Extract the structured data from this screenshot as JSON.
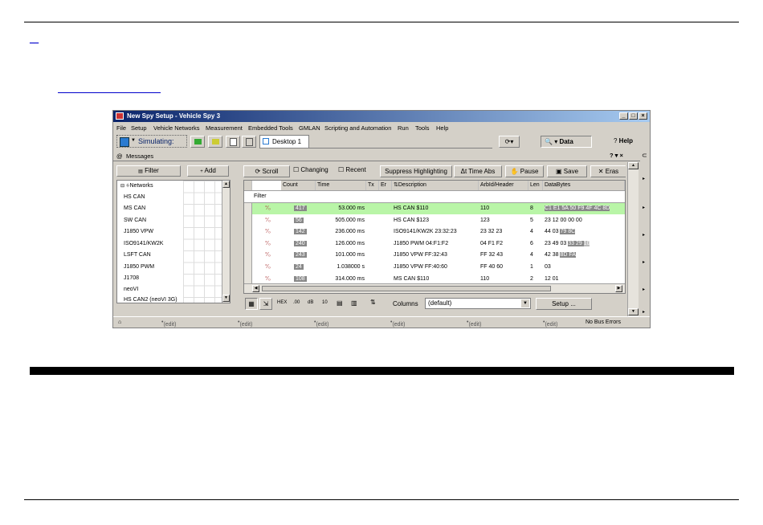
{
  "page": {
    "top_link": "__",
    "link2": ""
  },
  "app": {
    "title": "New Spy Setup - Vehicle Spy 3",
    "window_buttons": [
      "_",
      "□",
      "×"
    ],
    "menus": [
      "File",
      "Setup",
      "Vehicle Networks",
      "Measurement",
      "Embedded Tools",
      "GMLAN",
      "Scripting and Automation",
      "Run",
      "Tools",
      "Help"
    ],
    "toolbar": {
      "mode": "Simulating:",
      "desktop_tab": "Desktop 1",
      "data_label": "Data",
      "help_label": "Help"
    },
    "pane": {
      "title": "Messages",
      "controls": "? ▾ ×"
    },
    "left": {
      "filter_button": "Filter",
      "add_button": "Add"
    },
    "tree": {
      "root": "Networks",
      "items": [
        "HS CAN",
        "MS CAN",
        "SW CAN",
        "J1850 VPW",
        "ISO9141/KW2K",
        "LSFT CAN",
        "J1850 PWM",
        "J1708",
        "neoVI",
        "HS CAN2 (neoVI 3G)"
      ]
    },
    "msg_toolbar": {
      "scroll": "Scroll",
      "changing": "Changing",
      "recent": "Recent",
      "suppress": "Suppress Highlighting",
      "time_abs": "Time Abs",
      "pause": "Pause",
      "save": "Save",
      "erase": "Eras"
    },
    "columns": [
      "Count",
      "Time",
      "Tx",
      "Er",
      "Description",
      "ArbId/Header",
      "Len",
      "DataBytes"
    ],
    "filter_label": "Filter",
    "rows": [
      {
        "count": "417",
        "time": "53.000 ms",
        "description": "HS CAN $110",
        "arbid": "110",
        "len": "8",
        "data": "C1 E1 5A 50 F9 4F 4C 8D",
        "highlight": true
      },
      {
        "count": "56",
        "time": "505.000 ms",
        "description": "HS CAN $123",
        "arbid": "123",
        "len": "5",
        "data": "23 12 00 00 00"
      },
      {
        "count": "142",
        "time": "236.000 ms",
        "description": "ISO9141/KW2K 23:32:23",
        "arbid": "23 32 23",
        "len": "4",
        "data": "44 03 ",
        "data_hl": "79 8C"
      },
      {
        "count": "240",
        "time": "126.000 ms",
        "description": "J1850 PWM 04:F1:F2",
        "arbid": "04 F1 F2",
        "len": "6",
        "data": "23 49 03 ",
        "data_hl": "33 29 ",
        "data_tail": "10"
      },
      {
        "count": "243",
        "time": "101.000 ms",
        "description": "J1850 VPW FF:32:43",
        "arbid": "FF 32 43",
        "len": "4",
        "data": "42 38 ",
        "data_hl": "8D FA"
      },
      {
        "count": "24",
        "time": "1.038000 s",
        "description": "J1850 VPW FF:40:60",
        "arbid": "FF 40 60",
        "len": "1",
        "data": "03"
      },
      {
        "count": "108",
        "time": "314.000 ms",
        "description": "MS CAN $110",
        "arbid": "110",
        "len": "2",
        "data": "12 01"
      }
    ],
    "bottom": {
      "columns_label": "Columns",
      "columns_value": "(default)",
      "setup_button": "Setup ...",
      "small_buttons": [
        "HEX",
        ".00",
        "dB",
        "10"
      ]
    },
    "status": {
      "edit": "(edit)",
      "bus": "No Bus Errors"
    }
  }
}
